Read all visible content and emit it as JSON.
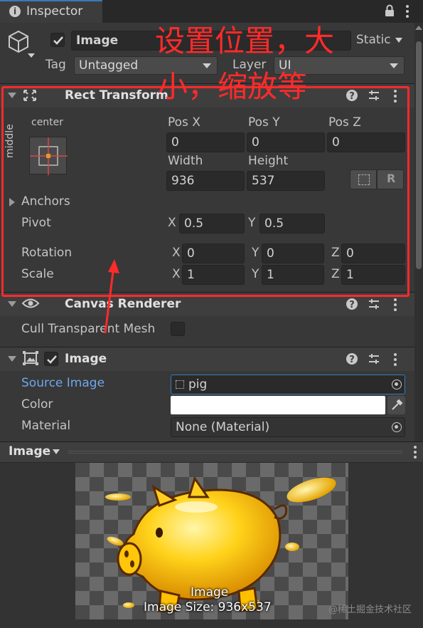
{
  "tab": {
    "title": "Inspector"
  },
  "object": {
    "name": "Image",
    "static_label": "Static",
    "tag_label": "Tag",
    "tag_value": "Untagged",
    "layer_label": "Layer",
    "layer_value": "UI",
    "active": true
  },
  "rect_transform": {
    "title": "Rect Transform",
    "anchor_preset_h": "center",
    "anchor_preset_v": "middle",
    "pos_x_label": "Pos X",
    "pos_x": "0",
    "pos_y_label": "Pos Y",
    "pos_y": "0",
    "pos_z_label": "Pos Z",
    "pos_z": "0",
    "width_label": "Width",
    "width": "936",
    "height_label": "Height",
    "height": "537",
    "r_button": "R",
    "anchors_label": "Anchors",
    "pivot_label": "Pivot",
    "pivot_x": "0.5",
    "pivot_y": "0.5",
    "rotation_label": "Rotation",
    "rot_x": "0",
    "rot_y": "0",
    "rot_z": "0",
    "scale_label": "Scale",
    "scale_x": "1",
    "scale_y": "1",
    "scale_z": "1",
    "axis_x": "X",
    "axis_y": "Y",
    "axis_z": "Z"
  },
  "annotation": {
    "line1": "设置位置，大",
    "line2": "小，缩放等",
    "color": "#ff2a2a"
  },
  "canvas_renderer": {
    "title": "Canvas Renderer",
    "cull_label": "Cull Transparent Mesh",
    "cull_checked": false
  },
  "image_component": {
    "title": "Image",
    "enabled": true,
    "source_label": "Source Image",
    "source_value": "pig",
    "color_label": "Color",
    "color_value": "#ffffff",
    "material_label": "Material",
    "material_value": "None (Material)"
  },
  "preview": {
    "title": "Image",
    "caption_name": "Image",
    "caption_size": "Image Size: 936x537"
  },
  "watermark": "@稀土掘金技术社区"
}
